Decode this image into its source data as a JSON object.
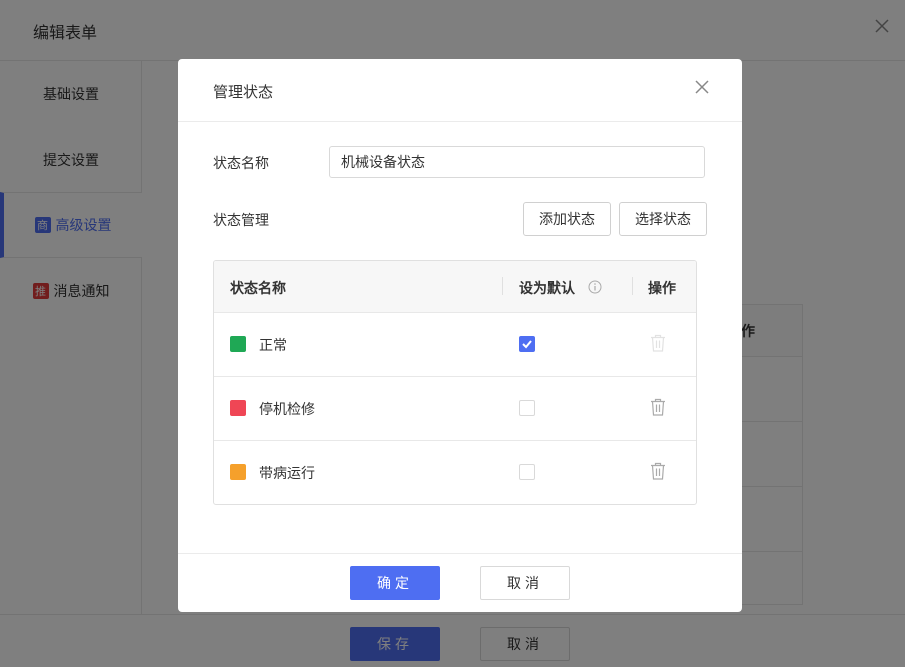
{
  "background": {
    "title": "编辑表单",
    "sidebar": {
      "items": [
        {
          "label": "基础设置"
        },
        {
          "label": "提交设置"
        },
        {
          "label": "高级设置",
          "badge": "商",
          "badge_color": "#4e6ef2"
        },
        {
          "label": "消息通知",
          "badge": "推",
          "badge_color": "#e23b3b"
        }
      ]
    },
    "table_header_partial": "作",
    "footer": {
      "save_label": "保存",
      "cancel_label": "取消"
    }
  },
  "modal": {
    "title": "管理状态",
    "name_label": "状态名称",
    "name_value": "机械设备状态",
    "manage_label": "状态管理",
    "add_button": "添加状态",
    "select_button": "选择状态",
    "table": {
      "headers": {
        "name": "状态名称",
        "default": "设为默认",
        "action": "操作"
      },
      "rows": [
        {
          "name": "正常",
          "color": "#1fa855",
          "is_default": true
        },
        {
          "name": "停机检修",
          "color": "#ef4655",
          "is_default": false
        },
        {
          "name": "带病运行",
          "color": "#f5a02b",
          "is_default": false
        }
      ]
    },
    "footer": {
      "confirm_label": "确定",
      "cancel_label": "取消"
    }
  },
  "colors": {
    "accent": "#4e6ef2"
  }
}
